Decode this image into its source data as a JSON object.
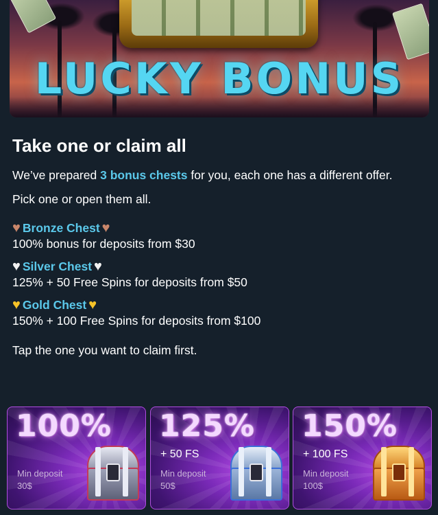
{
  "banner": {
    "logo_text": "LUCKY BONUS"
  },
  "heading": "Take one or claim all",
  "intro": {
    "before": "We’ve prepared ",
    "highlight": "3 bonus chests",
    "after": " for you, each one has a different offer."
  },
  "pick_text": "Pick one or open them all.",
  "chests": [
    {
      "title": "Bronze Chest",
      "heart_icon": "brown-heart-icon",
      "heart_color": "#c9866a",
      "desc": "100% bonus for deposits from $30"
    },
    {
      "title": "Silver Chest",
      "heart_icon": "white-heart-icon",
      "heart_color": "#f2f2f2",
      "desc": "125% + 50 Free Spins for deposits from $50"
    },
    {
      "title": "Gold Chest",
      "heart_icon": "yellow-heart-icon",
      "heart_color": "#f7c328",
      "desc": "150% + 100 Free Spins for deposits from $100"
    }
  ],
  "tap_text": "Tap the one you want to claim first.",
  "cards": [
    {
      "percent": "100%",
      "fs": "",
      "min_label": "Min deposit",
      "min_value": "30$",
      "chest_icon": "silver-treasure-chest-icon"
    },
    {
      "percent": "125%",
      "fs": "+ 50 FS",
      "min_label": "Min deposit",
      "min_value": "50$",
      "chest_icon": "blue-treasure-chest-icon"
    },
    {
      "percent": "150%",
      "fs": "+ 100 FS",
      "min_label": "Min deposit",
      "min_value": "100$",
      "chest_icon": "gold-treasure-chest-icon"
    }
  ],
  "colors": {
    "background": "#15202b",
    "accent": "#5bc8ea",
    "card_purple": "#7a2ab8"
  }
}
